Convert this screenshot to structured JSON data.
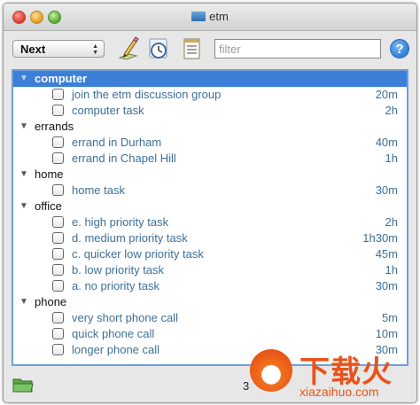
{
  "window": {
    "title": "etm"
  },
  "toolbar": {
    "view_select": "Next",
    "filter_placeholder": "filter",
    "help_label": "?",
    "icons": [
      "edit-icon",
      "clock-icon",
      "list-icon"
    ]
  },
  "groups": [
    {
      "label": "computer",
      "selected": true,
      "tasks": [
        {
          "label": "join the etm discussion group",
          "duration": "20m"
        },
        {
          "label": "computer task",
          "duration": "2h"
        }
      ]
    },
    {
      "label": "errands",
      "selected": false,
      "tasks": [
        {
          "label": "errand in Durham",
          "duration": "40m"
        },
        {
          "label": "errand in Chapel Hill",
          "duration": "1h"
        }
      ]
    },
    {
      "label": "home",
      "selected": false,
      "tasks": [
        {
          "label": "home task",
          "duration": "30m"
        }
      ]
    },
    {
      "label": "office",
      "selected": false,
      "tasks": [
        {
          "label": "e. high priority task",
          "duration": "2h"
        },
        {
          "label": "d. medium priority task",
          "duration": "1h30m"
        },
        {
          "label": "c. quicker low priority task",
          "duration": "45m"
        },
        {
          "label": "b. low priority task",
          "duration": "1h"
        },
        {
          "label": "a. no priority task",
          "duration": "30m"
        }
      ]
    },
    {
      "label": "phone",
      "selected": false,
      "tasks": [
        {
          "label": "very short phone call",
          "duration": "5m"
        },
        {
          "label": "quick phone call",
          "duration": "10m"
        },
        {
          "label": "longer phone call",
          "duration": "30m"
        }
      ]
    }
  ],
  "status": {
    "text": "3"
  },
  "watermark": {
    "cn": "下载火",
    "url": "xiazaihuo.com"
  },
  "colors": {
    "selection": "#3b7fd8",
    "task_text": "#3e6f97",
    "accent_orange": "#e9531a"
  }
}
